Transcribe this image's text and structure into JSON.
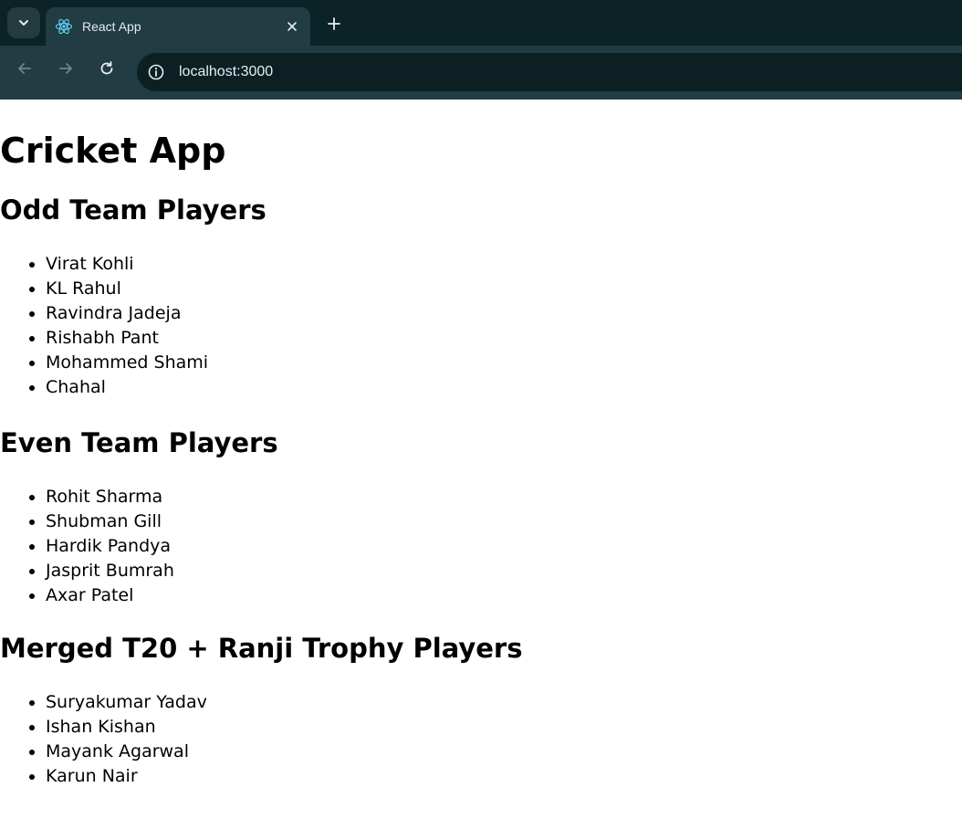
{
  "browser": {
    "tab_title": "React App",
    "url": "localhost:3000",
    "icons": {
      "tab_search": "chevron-down-icon",
      "favicon": "react-logo-icon",
      "close": "close-icon",
      "new_tab": "plus-icon",
      "back": "arrow-left-icon",
      "forward": "arrow-right-icon",
      "reload": "reload-icon",
      "site_info": "info-icon"
    }
  },
  "app": {
    "title": "Cricket App",
    "sections": [
      {
        "heading": "Odd Team Players",
        "players": [
          "Virat Kohli",
          "KL Rahul",
          "Ravindra Jadeja",
          "Rishabh Pant",
          "Mohammed Shami",
          "Chahal"
        ]
      },
      {
        "heading": "Even Team Players",
        "players": [
          "Rohit Sharma",
          "Shubman Gill",
          "Hardik Pandya",
          "Jasprit Bumrah",
          "Axar Patel"
        ]
      },
      {
        "heading": "Merged T20 + Ranji Trophy Players",
        "players": [
          "Suryakumar Yadav",
          "Ishan Kishan",
          "Mayank Agarwal",
          "Karun Nair"
        ]
      }
    ]
  }
}
